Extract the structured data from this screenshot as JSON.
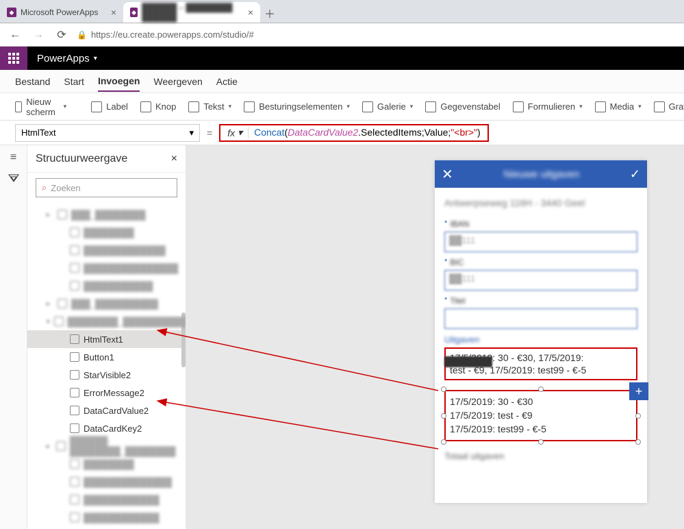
{
  "browser": {
    "tabs": [
      {
        "title": "Microsoft PowerApps",
        "active": false
      },
      {
        "title": "██████ – ████████ ██████",
        "active": true
      }
    ],
    "url": "https://eu.create.powerapps.com/studio/#"
  },
  "app": {
    "title": "PowerApps"
  },
  "menubar": {
    "items": [
      "Bestand",
      "Start",
      "Invoegen",
      "Weergeven",
      "Actie"
    ],
    "active": "Invoegen"
  },
  "ribbon": {
    "new_screen": "Nieuw scherm",
    "label": "Label",
    "button": "Knop",
    "text": "Tekst",
    "controls": "Besturingselementen",
    "gallery": "Galerie",
    "datatable": "Gegevenstabel",
    "forms": "Formulieren",
    "media": "Media",
    "charts": "Grafieken"
  },
  "formula": {
    "property": "HtmlText",
    "expr_fn": "Concat",
    "expr_open": "(",
    "expr_ident": "DataCardValue2",
    "expr_rest": ".SelectedItems;Value;",
    "expr_str": "\"<br>\"",
    "expr_close": ")"
  },
  "tree": {
    "title": "Structuurweergave",
    "search_placeholder": "Zoeken",
    "items": [
      {
        "label": "███_████████",
        "indent": 1,
        "blur": true,
        "chev": "▸"
      },
      {
        "label": "████████",
        "indent": 2,
        "blur": true
      },
      {
        "label": "█████████████",
        "indent": 2,
        "blur": true
      },
      {
        "label": "███████████████",
        "indent": 2,
        "blur": true
      },
      {
        "label": "███████████",
        "indent": 2,
        "blur": true
      },
      {
        "label": "███_██████████",
        "indent": 1,
        "blur": true,
        "chev": "▸"
      },
      {
        "label": "████████_██████████",
        "indent": 1,
        "blur": true,
        "chev": "▾"
      },
      {
        "label": "HtmlText1",
        "indent": 2,
        "blur": false,
        "selected": true
      },
      {
        "label": "Button1",
        "indent": 2,
        "blur": false
      },
      {
        "label": "StarVisible2",
        "indent": 2,
        "blur": false
      },
      {
        "label": "ErrorMessage2",
        "indent": 2,
        "blur": false
      },
      {
        "label": "DataCardValue2",
        "indent": 2,
        "blur": false
      },
      {
        "label": "DataCardKey2",
        "indent": 2,
        "blur": false
      },
      {
        "label": "██████-████████_████████",
        "indent": 1,
        "blur": true,
        "chev": "▸"
      },
      {
        "label": "████████",
        "indent": 2,
        "blur": true
      },
      {
        "label": "██████████████",
        "indent": 2,
        "blur": true
      },
      {
        "label": "████████████",
        "indent": 2,
        "blur": true
      },
      {
        "label": "████████████",
        "indent": 2,
        "blur": true
      }
    ]
  },
  "phone": {
    "header_title": "Nieuwe uitgaven",
    "address": "Antwerpseweg 116H - 3440 Geel",
    "fields": [
      {
        "label": "IBAN",
        "value": "██111"
      },
      {
        "label": "BIC",
        "value": "██111"
      },
      {
        "label": "Titel",
        "value": ""
      }
    ],
    "section_label": "Uitgaven",
    "box1_line1": "17/5/2019: 30 - €30, 17/5/2019:",
    "box1_line2": "test - €9, 17/5/2019: test99 - €-5",
    "box2_line1": "17/5/2019: 30 - €30",
    "box2_line2": "17/5/2019: test - €9",
    "box2_line3": "17/5/2019: test99 - €-5",
    "footer_label": "Totaal uitgaven"
  }
}
